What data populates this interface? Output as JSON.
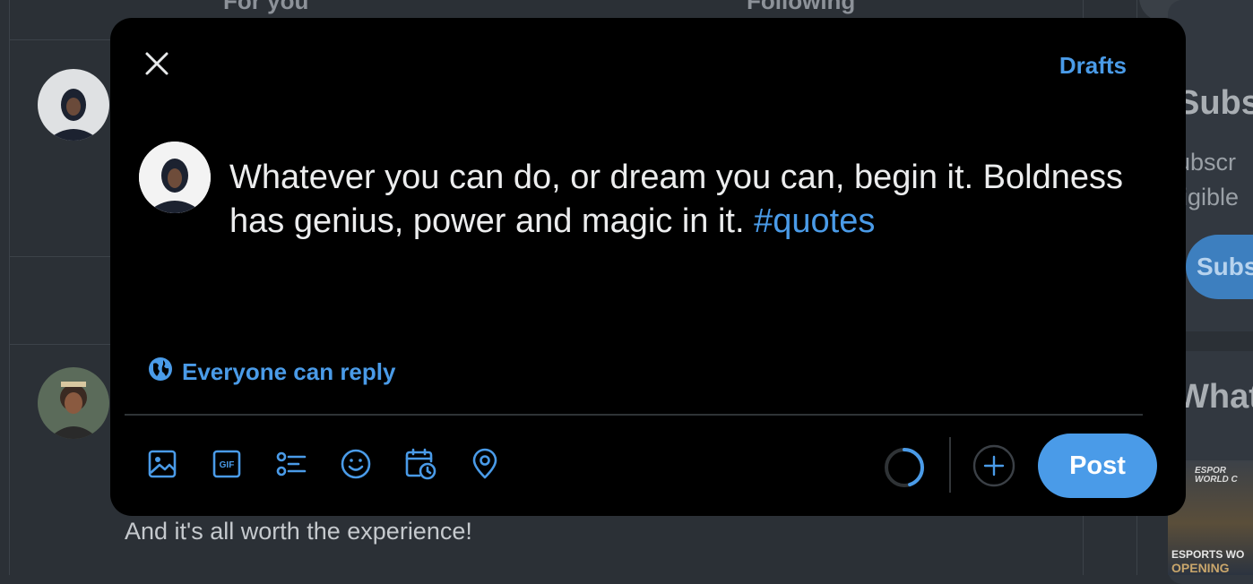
{
  "background": {
    "tabs": {
      "for_you": "For you",
      "following": "Following"
    },
    "timeline_text": "And it's all worth the experience!",
    "right_sidebar": {
      "subscribe_title": "Subs",
      "subscribe_desc_line1": "ubscr",
      "subscribe_desc_line2": "ligible",
      "subscribe_button": "Subs",
      "whats_happening": "What",
      "promo_line1": "ESPOR",
      "promo_line2": "WORLD C",
      "promo_line3": "ESPORTS WO",
      "promo_line4": "OPENING"
    }
  },
  "compose": {
    "drafts_label": "Drafts",
    "text_main": "Whatever you can do, or dream you can, begin it. Boldness has genius, power and magic in it. ",
    "hashtag": "#quotes",
    "reply_setting": "Everyone can reply",
    "post_label": "Post",
    "toolbar_icons": [
      "media-icon",
      "gif-icon",
      "poll-icon",
      "emoji-icon",
      "schedule-icon",
      "location-icon"
    ],
    "character_progress": 0.45
  },
  "colors": {
    "accent": "#4a9be8",
    "modal_bg": "#000000",
    "overlay": "#2b3036"
  }
}
